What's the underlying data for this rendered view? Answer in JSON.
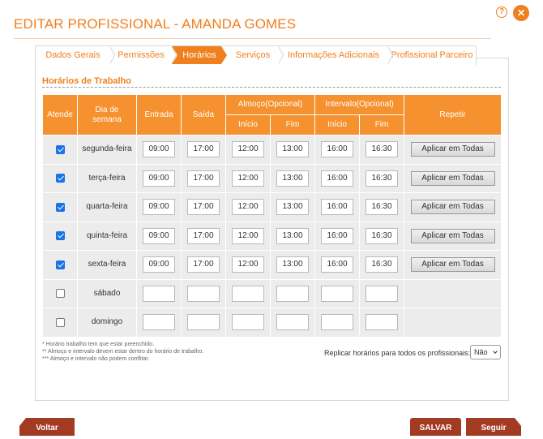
{
  "header": {
    "title": "EDITAR PROFISSIONAL - AMANDA GOMES",
    "help_glyph": "?",
    "close_glyph": "✕"
  },
  "tabs": [
    {
      "label": "Dados Gerais",
      "active": false
    },
    {
      "label": "Permissões",
      "active": false
    },
    {
      "label": "Horários",
      "active": true
    },
    {
      "label": "Serviços",
      "active": false
    },
    {
      "label": "Informações Adicionais",
      "active": false
    },
    {
      "label": "Profissional Parceiro",
      "active": false
    }
  ],
  "section": {
    "title": "Horários de Trabalho"
  },
  "table": {
    "headers": {
      "atende": "Atende",
      "dia": "Dia de semana",
      "entrada": "Entrada",
      "saida": "Saída",
      "almoco": "Almoço(Opcional)",
      "intervalo": "Intervalo(Opcional)",
      "inicio": "Início",
      "fim": "Fim",
      "repetir": "Repetir"
    },
    "apply_label": "Aplicar em Todas",
    "rows": [
      {
        "day": "segunda-feira",
        "checked": true,
        "entrada": "09:00",
        "saida": "17:00",
        "almoco_inicio": "12:00",
        "almoco_fim": "13:00",
        "intervalo_inicio": "16:00",
        "intervalo_fim": "16:30"
      },
      {
        "day": "terça-feira",
        "checked": true,
        "entrada": "09:00",
        "saida": "17:00",
        "almoco_inicio": "12:00",
        "almoco_fim": "13:00",
        "intervalo_inicio": "16:00",
        "intervalo_fim": "16:30"
      },
      {
        "day": "quarta-feira",
        "checked": true,
        "entrada": "09:00",
        "saida": "17:00",
        "almoco_inicio": "12:00",
        "almoco_fim": "13:00",
        "intervalo_inicio": "16:00",
        "intervalo_fim": "16:30"
      },
      {
        "day": "quinta-feira",
        "checked": true,
        "entrada": "09:00",
        "saida": "17:00",
        "almoco_inicio": "12:00",
        "almoco_fim": "13:00",
        "intervalo_inicio": "16:00",
        "intervalo_fim": "16:30"
      },
      {
        "day": "sexta-feira",
        "checked": true,
        "entrada": "09:00",
        "saida": "17:00",
        "almoco_inicio": "12:00",
        "almoco_fim": "13:00",
        "intervalo_inicio": "16:00",
        "intervalo_fim": "16:30"
      },
      {
        "day": "sábado",
        "checked": false,
        "entrada": "",
        "saida": "",
        "almoco_inicio": "",
        "almoco_fim": "",
        "intervalo_inicio": "",
        "intervalo_fim": ""
      },
      {
        "day": "domingo",
        "checked": false,
        "entrada": "",
        "saida": "",
        "almoco_inicio": "",
        "almoco_fim": "",
        "intervalo_inicio": "",
        "intervalo_fim": ""
      }
    ]
  },
  "notes": [
    "* Horário trabalho tem que estar preenchido.",
    "** Almoço e intervalo devem estar dentro do horário de trabalho.",
    "*** Almoço e intervalo não podem conflitar."
  ],
  "replicate": {
    "label": "Replicar horários para todos os profissionais:",
    "selected": "Não"
  },
  "footer": {
    "voltar": "Voltar",
    "salvar": "SALVAR",
    "seguir": "Seguir"
  },
  "colors": {
    "accent": "#f07f1e",
    "header_bg": "#f5922f",
    "nav_button": "#a33a22",
    "checkbox": "#1a73e8"
  }
}
